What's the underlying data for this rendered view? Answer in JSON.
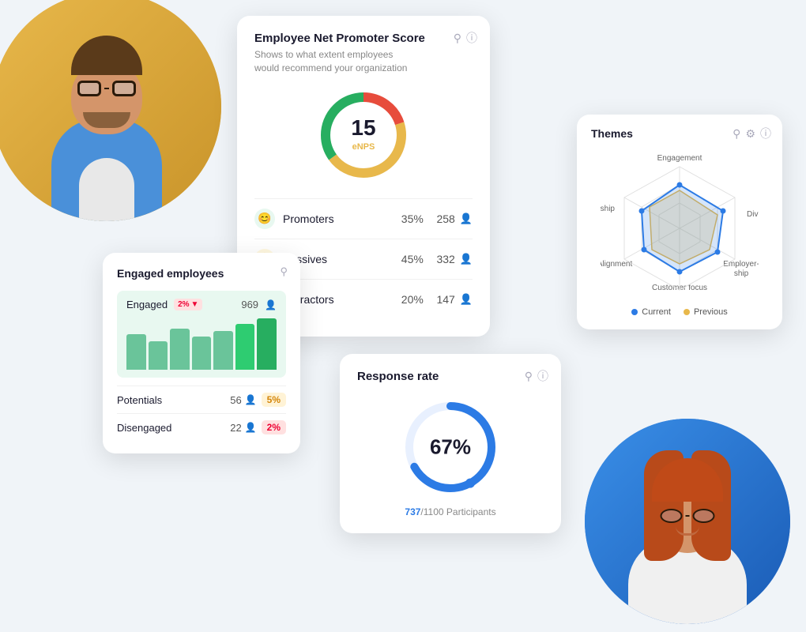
{
  "enps": {
    "title": "Employee Net Promoter Score",
    "subtitle": "Shows to what extent employees would recommend your organization",
    "score": "15",
    "score_label": "eNPS",
    "promoters": {
      "label": "Promoters",
      "pct": "35%",
      "count": "258"
    },
    "passives": {
      "label": "Passives",
      "pct": "45%",
      "count": "332"
    },
    "detractors": {
      "label": "Detractors",
      "pct": "20%",
      "count": "147"
    }
  },
  "engaged": {
    "title": "Engaged employees",
    "engaged_label": "Engaged",
    "change": "2%",
    "engaged_count": "969",
    "potentials_label": "Potentials",
    "potentials_count": "56",
    "potentials_pct": "5%",
    "disengaged_label": "Disengaged",
    "disengaged_count": "22",
    "disengaged_pct": "2%"
  },
  "response": {
    "title": "Response rate",
    "pct": "67%",
    "count": "737",
    "total": "1100",
    "participants_label": "Participants"
  },
  "themes": {
    "title": "Themes",
    "labels": [
      "Engagement",
      "Diversity",
      "Employer-ship",
      "Customer focus",
      "Alignment",
      "Leadership"
    ],
    "legend_current": "Current",
    "legend_previous": "Previous",
    "current_color": "#2c7be5",
    "previous_color": "#e8b84b"
  },
  "icons": {
    "pin": "⚲",
    "info": "ⓘ",
    "gear": "⚙",
    "people": "⚇",
    "arrow_down": "▼"
  }
}
